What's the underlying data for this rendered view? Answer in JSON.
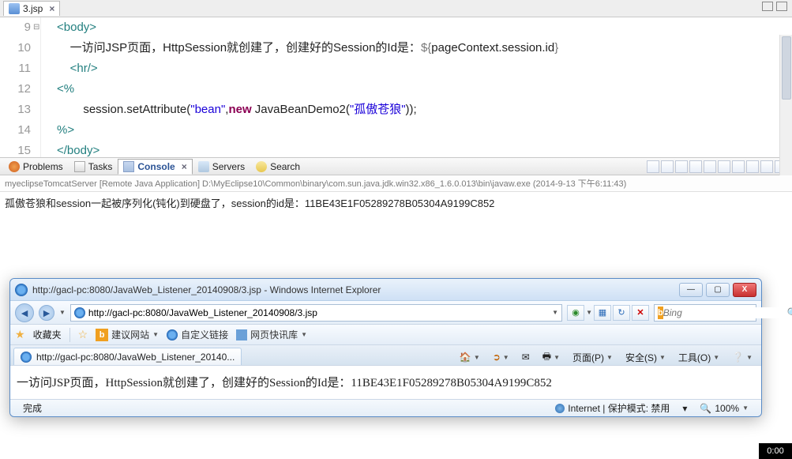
{
  "editor": {
    "tab_label": "3.jsp",
    "lines": [
      {
        "num": "9",
        "html": "<span class='tag'>&lt;body&gt;</span>"
      },
      {
        "num": "10",
        "html": "    <span class='plain'>一访问JSP页面，HttpSession就创建了，创建好的Session的Id是：</span><span class='el'>${</span><span class='plain'>pageContext.session.id</span><span class='el'>}</span>"
      },
      {
        "num": "11",
        "html": "    <span class='tag'>&lt;hr/&gt;</span>"
      },
      {
        "num": "12",
        "html": "<span class='tag'>&lt;%</span>"
      },
      {
        "num": "13",
        "html": "        <span class='plain'>session.setAttribute(</span><span class='str'>\"bean\"</span><span class='plain'>,</span><span class='kw'>new</span><span class='plain'> JavaBeanDemo2(</span><span class='str'>\"孤傲苍狼\"</span><span class='plain'>));</span>"
      },
      {
        "num": "14",
        "html": "<span class='tag'>%&gt;</span>"
      },
      {
        "num": "15",
        "html": "<span class='tag'>&lt;/body&gt;</span>"
      }
    ]
  },
  "panel": {
    "tabs": {
      "problems": "Problems",
      "tasks": "Tasks",
      "console": "Console",
      "servers": "Servers",
      "search": "Search"
    },
    "process": "myeclipseTomcatServer [Remote Java Application] D:\\MyEclipse10\\Common\\binary\\com.sun.java.jdk.win32.x86_1.6.0.013\\bin\\javaw.exe (2014-9-13 下午6:11:43)",
    "console_out": "孤傲苍狼和session一起被序列化(钝化)到硬盘了，session的id是：11BE43E1F05289278B05304A9199C852"
  },
  "ie": {
    "title": "http://gacl-pc:8080/JavaWeb_Listener_20140908/3.jsp - Windows Internet Explorer",
    "url": "http://gacl-pc:8080/JavaWeb_Listener_20140908/3.jsp",
    "search_placeholder": "Bing",
    "fav": {
      "favorites": "收藏夹",
      "suggested": "建议网站",
      "custom": "自定义链接",
      "quick": "网页快讯库"
    },
    "tab_label": "http://gacl-pc:8080/JavaWeb_Listener_20140...",
    "menu": {
      "page": "页面(P)",
      "safety": "安全(S)",
      "tools": "工具(O)"
    },
    "content": "一访问JSP页面，HttpSession就创建了，创建好的Session的Id是：11BE43E1F05289278B05304A9199C852",
    "status": {
      "done": "完成",
      "zone": "Internet | 保护模式: 禁用",
      "zoom": "100%"
    }
  },
  "clock": "0:00"
}
